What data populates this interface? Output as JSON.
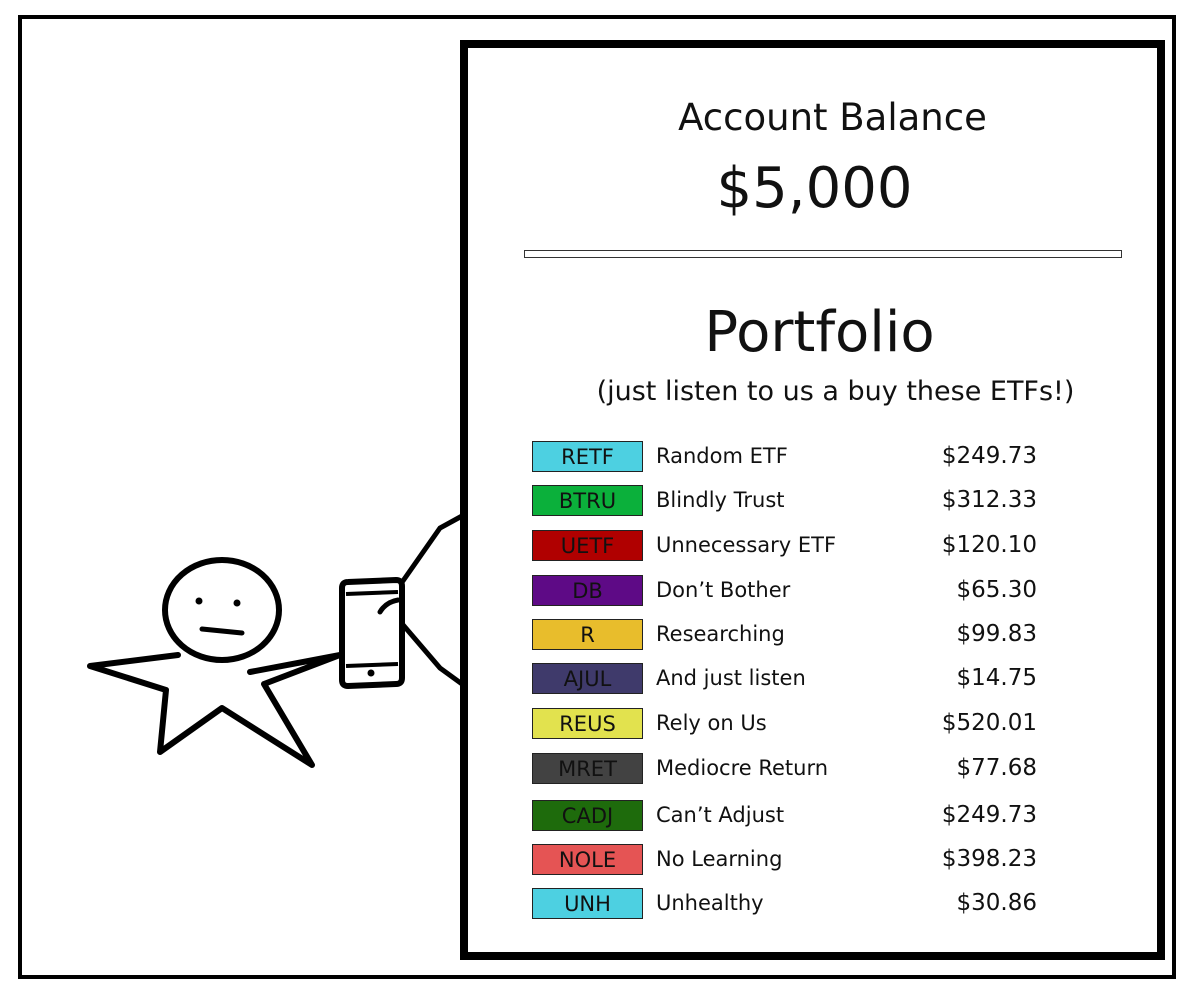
{
  "account": {
    "title": "Account Balance",
    "balance": "$5,000"
  },
  "portfolio": {
    "title": "Portfolio",
    "subtitle": "(just listen to us a buy these ETFs!)",
    "holdings": [
      {
        "ticker": "RETF",
        "name": "Random ETF",
        "price": "$249.73",
        "color": "#4dd0e1"
      },
      {
        "ticker": "BTRU",
        "name": "Blindly Trust",
        "price": "$312.33",
        "color": "#0bb03b"
      },
      {
        "ticker": "UETF",
        "name": "Unnecessary ETF",
        "price": "$120.10",
        "color": "#b00000"
      },
      {
        "ticker": "DB",
        "name": "Don’t Bother",
        "price": "$65.30",
        "color": "#5e0a86"
      },
      {
        "ticker": "R",
        "name": "Researching",
        "price": "$99.83",
        "color": "#e8bd2c"
      },
      {
        "ticker": "AJUL",
        "name": "And just listen",
        "price": "$14.75",
        "color": "#3f3a6b"
      },
      {
        "ticker": "REUS",
        "name": "Rely on Us",
        "price": "$520.01",
        "color": "#e2e24e"
      },
      {
        "ticker": "MRET",
        "name": "Mediocre Return",
        "price": "$77.68",
        "color": "#424242"
      },
      {
        "ticker": "CADJ",
        "name": "Can’t Adjust",
        "price": "$249.73",
        "color": "#1e6b0c"
      },
      {
        "ticker": "NOLE",
        "name": "No Learning",
        "price": "$398.23",
        "color": "#e55454"
      },
      {
        "ticker": "UNH",
        "name": "Unhealthy",
        "price": "$30.86",
        "color": "#4dd0e1"
      }
    ]
  }
}
